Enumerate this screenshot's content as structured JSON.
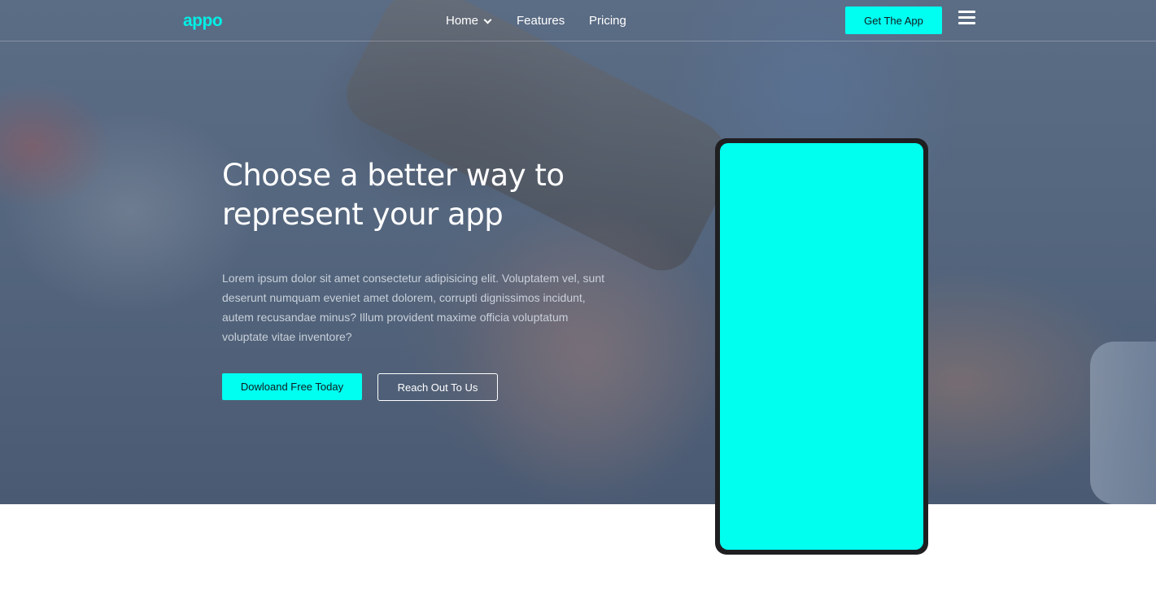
{
  "nav": {
    "logo": "appo",
    "links": [
      {
        "label": "Home",
        "has_dropdown": true
      },
      {
        "label": "Features"
      },
      {
        "label": "Pricing"
      }
    ],
    "cta_label": "Get The App",
    "menu_icon": "hamburger-icon"
  },
  "hero": {
    "headline_line1": "Choose a better way to",
    "headline_line2": "represent your app",
    "lead": "Lorem ipsum dolor sit amet consectetur adipisicing elit. Voluptatem vel, sunt deserunt numquam eveniet amet dolorem, corrupti dignissimos incidunt, autem recusandae minus? Illum provident maxime officia voluptatum voluptate vitae inventore?",
    "primary_button": "Dowloand Free Today",
    "secondary_button": "Reach Out To Us"
  },
  "colors": {
    "accent": "#00fff0",
    "hero_overlay": "#55677f",
    "device_frame": "#1f1f22"
  }
}
